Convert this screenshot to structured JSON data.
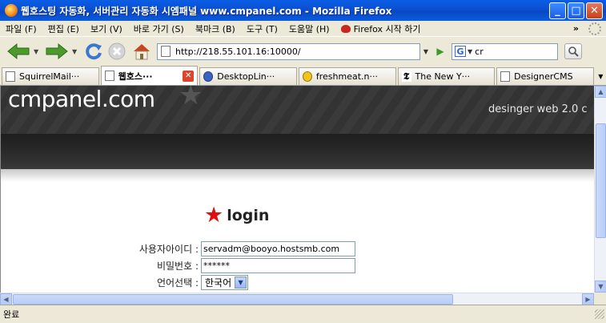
{
  "window": {
    "title": "웹호스팅 자동화, 서버관리 자동화 시엠패널 www.cmpanel.com - Mozilla Firefox",
    "minimize": "_",
    "maximize": "□",
    "close": "✕"
  },
  "menu": {
    "items": [
      "파일 (F)",
      "편집 (E)",
      "보기 (V)",
      "바로 가기 (S)",
      "북마크 (B)",
      "도구 (T)",
      "도움말 (H)"
    ],
    "firefox_start": "Firefox 시작 하기",
    "overflow": "»"
  },
  "nav": {
    "url": "http://218.55.101.16:10000/",
    "search_value": "cr",
    "search_engine_letter": "G"
  },
  "tabs": [
    {
      "label": "SquirrelMail···",
      "icon": "page-icon",
      "active": false
    },
    {
      "label": "웹호스···",
      "icon": "page-icon",
      "active": true
    },
    {
      "label": "DesktopLin···",
      "icon": "penguin-icon",
      "active": false
    },
    {
      "label": "freshmeat.n···",
      "icon": "freshmeat-icon",
      "active": false
    },
    {
      "label": "The New Y···",
      "icon": "nyt-icon",
      "active": false
    },
    {
      "label": "DesignerCMS",
      "icon": "page-icon",
      "active": false
    }
  ],
  "page": {
    "logo": "cmpanel.com",
    "tagline": "desinger web 2.0 c",
    "login_title": "login",
    "fields": {
      "user_label": "사용자아이디 :",
      "user_value": "servadm@booyo.hostsmb.com",
      "password_label": "비밀번호 :",
      "password_value": "******",
      "language_label": "언어선택 :",
      "language_value": "한국어"
    }
  },
  "status": {
    "text": "완료"
  },
  "colors": {
    "titlebar": "#0b55d8",
    "header_bg": "#363636",
    "login_star": "#e01010"
  }
}
